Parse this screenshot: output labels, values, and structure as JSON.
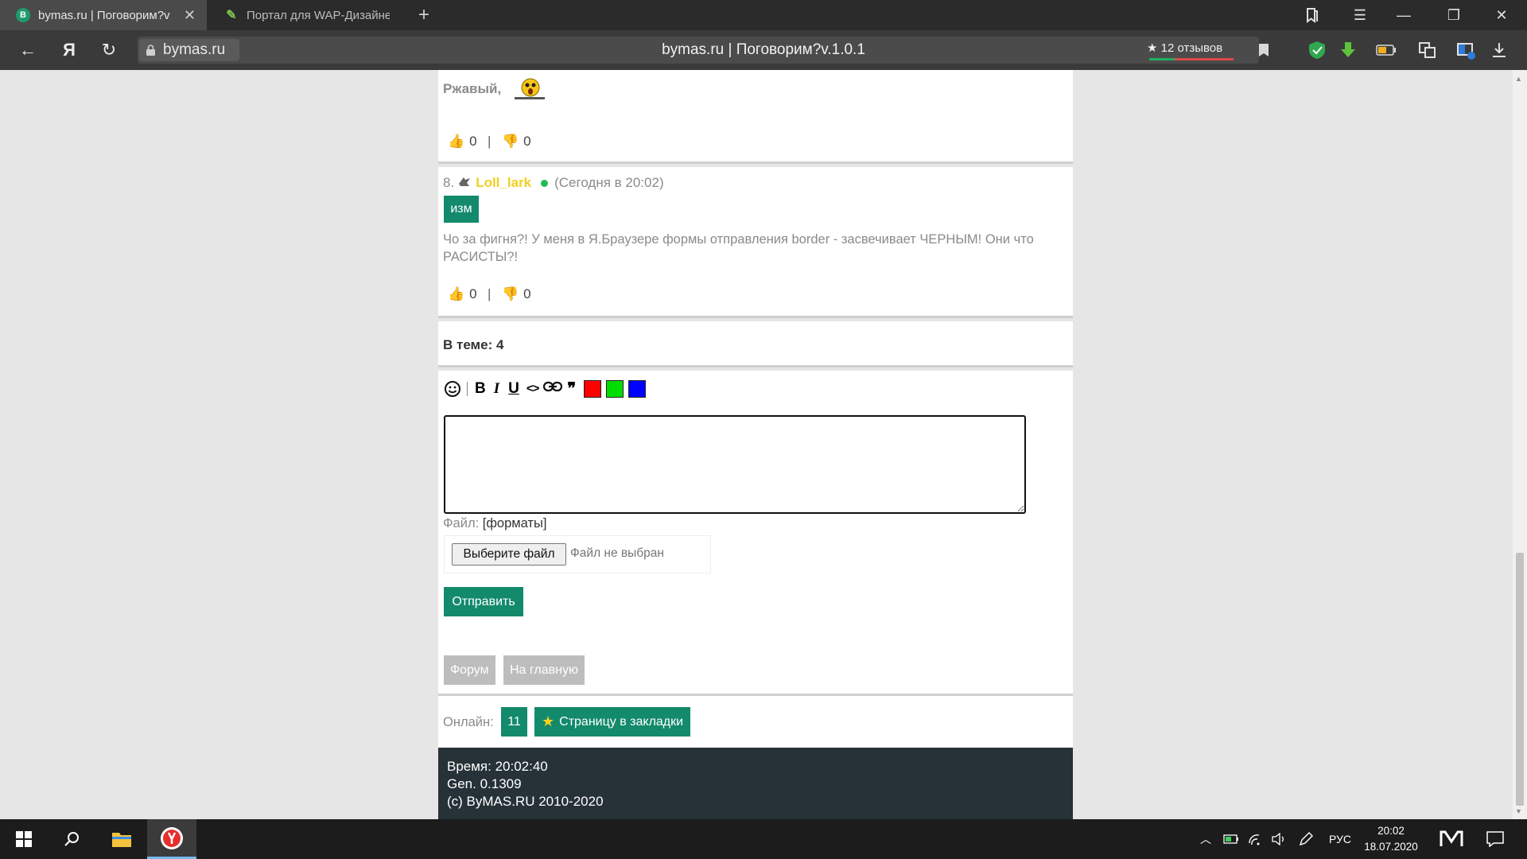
{
  "browser": {
    "tabs": [
      {
        "favicon": "B",
        "title": "bymas.ru | Поговорим?v"
      },
      {
        "title": "Портал для WAP-Дизайне"
      }
    ],
    "address_domain": "bymas.ru",
    "page_title": "bymas.ru | Поговорим?v.1.0.1",
    "yandex_logo": "Я",
    "reviews_label": "★ 12 отзывов"
  },
  "post7": {
    "text": "Ржавый,",
    "likes": "0",
    "separator": "|",
    "dislikes": "0"
  },
  "post8": {
    "number": "8.",
    "author": "Loll_lark",
    "time": "(Сегодня в 20:02)",
    "edit_label": "изм",
    "message": "Чо за фигня?! У меня в Я.Браузере формы отправления border - засвечивает ЧЕРНЫМ! Они что РАСИСТЫ?!",
    "likes": "0",
    "separator": "|",
    "dislikes": "0"
  },
  "topic": {
    "label": "В теме: 4"
  },
  "editor": {
    "toolbar": {
      "bold": "B",
      "italic": "I",
      "underline": "U",
      "code": "<>",
      "quote": "❞"
    },
    "colors": [
      "#ff0000",
      "#00dd00",
      "#0000ff"
    ],
    "textarea_value": "",
    "file_label": "Файл:",
    "formats_link": "[форматы]",
    "choose_file": "Выберите файл",
    "no_file": "Файл не выбран",
    "submit": "Отправить"
  },
  "nav": {
    "forum": "Форум",
    "home": "На главную"
  },
  "online": {
    "label": "Онлайн:",
    "count": "11",
    "bookmark": "Страницу в закладки"
  },
  "footer": {
    "time": "Время: 20:02:40",
    "gen": "Gen. 0.1309",
    "copyright": "(c) ByMAS.RU 2010-2020"
  },
  "taskbar": {
    "lang": "РУС",
    "clock_time": "20:02",
    "clock_date": "18.07.2020"
  }
}
